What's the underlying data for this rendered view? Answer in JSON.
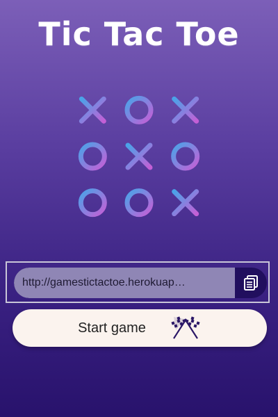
{
  "title": "Tic Tac Toe",
  "board": {
    "cells": [
      "X",
      "O",
      "X",
      "O",
      "X",
      "O",
      "O",
      "O",
      "X"
    ],
    "colors": {
      "line_start": "#4aa3e8",
      "line_end": "#c45fd6"
    }
  },
  "url_field": {
    "value": "http://gamestictactoe.herokuap…",
    "copy_icon": "copy-icon"
  },
  "start_button": {
    "label": "Start game",
    "icon": "checkered-flags-icon"
  },
  "colors": {
    "accent_dark": "#210f5e",
    "field_bg": "#8f86b5",
    "button_bg": "#fbf3ee"
  }
}
